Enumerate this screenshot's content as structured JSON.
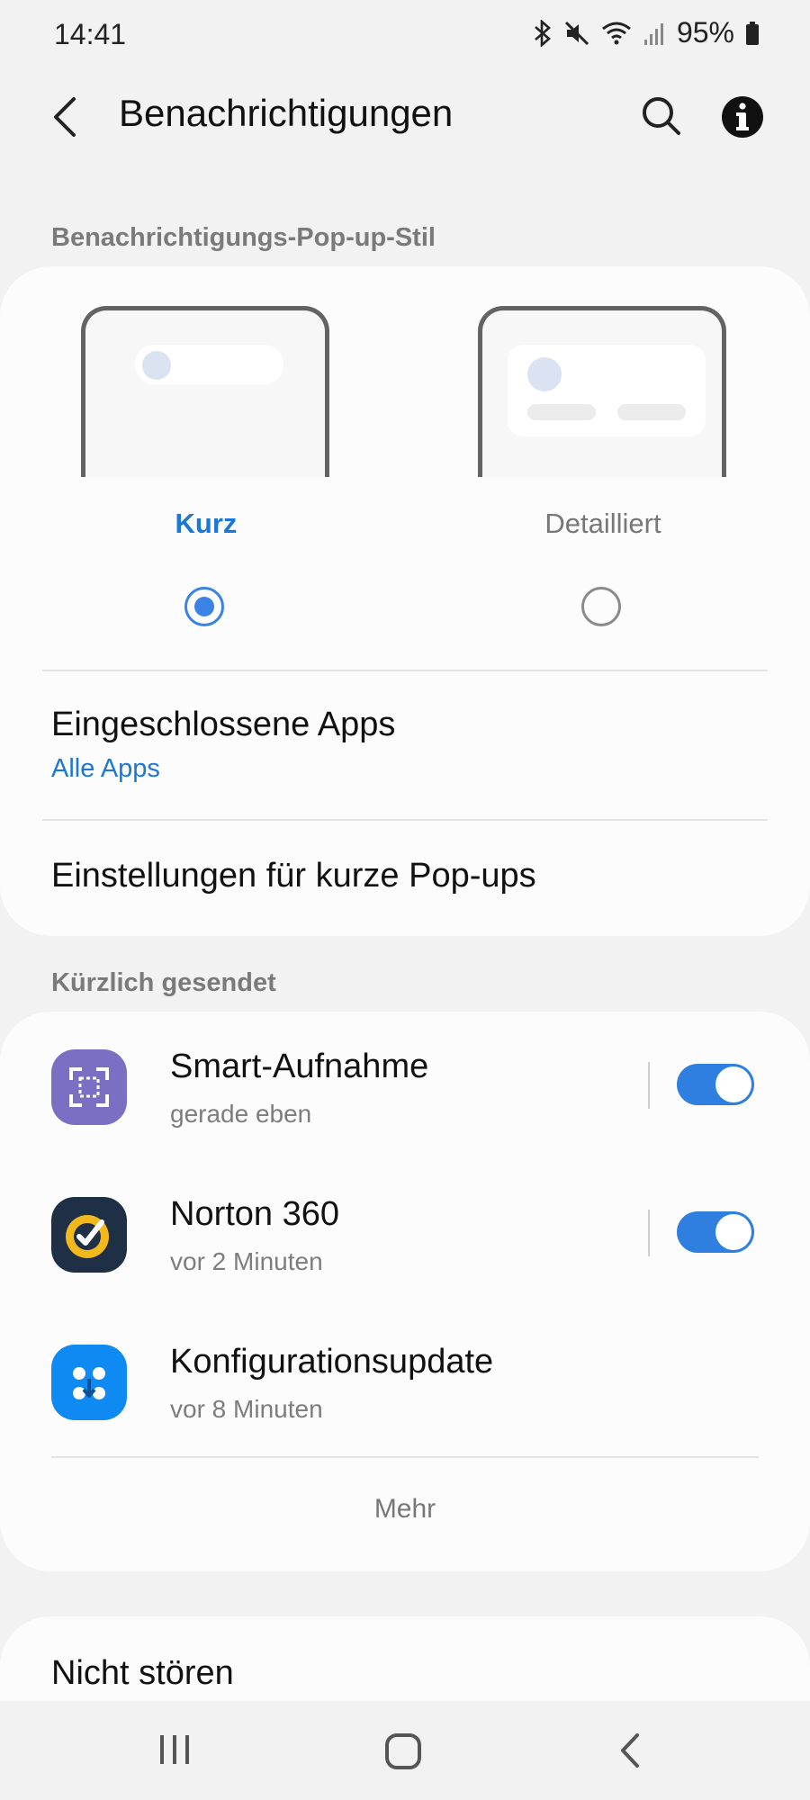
{
  "status_bar": {
    "time": "14:41",
    "battery": "95%"
  },
  "header": {
    "title": "Benachrichtigungen"
  },
  "popup_style": {
    "section_label": "Benachrichtigungs-Pop-up-Stil",
    "options": [
      {
        "label": "Kurz",
        "selected": true
      },
      {
        "label": "Detailliert",
        "selected": false
      }
    ],
    "included_apps": {
      "title": "Eingeschlossene Apps",
      "value": "Alle Apps"
    },
    "brief_settings": {
      "title": "Einstellungen für kurze Pop-ups"
    }
  },
  "recent": {
    "section_label": "Kürzlich gesendet",
    "apps": [
      {
        "name": "Smart-Aufnahme",
        "time": "gerade eben",
        "enabled": true,
        "icon": "smart-capture-icon"
      },
      {
        "name": "Norton 360",
        "time": "vor 2 Minuten",
        "enabled": true,
        "icon": "norton-icon"
      },
      {
        "name": "Konfigurationsupdate",
        "time": "vor 8 Minuten",
        "icon": "config-update-icon"
      }
    ],
    "more_label": "Mehr"
  },
  "dnd": {
    "title": "Nicht stören"
  },
  "colors": {
    "accent": "#1b78d8",
    "toggle_on": "#2f7fe0",
    "background": "#f2f2f2",
    "card": "#fcfcfc"
  }
}
